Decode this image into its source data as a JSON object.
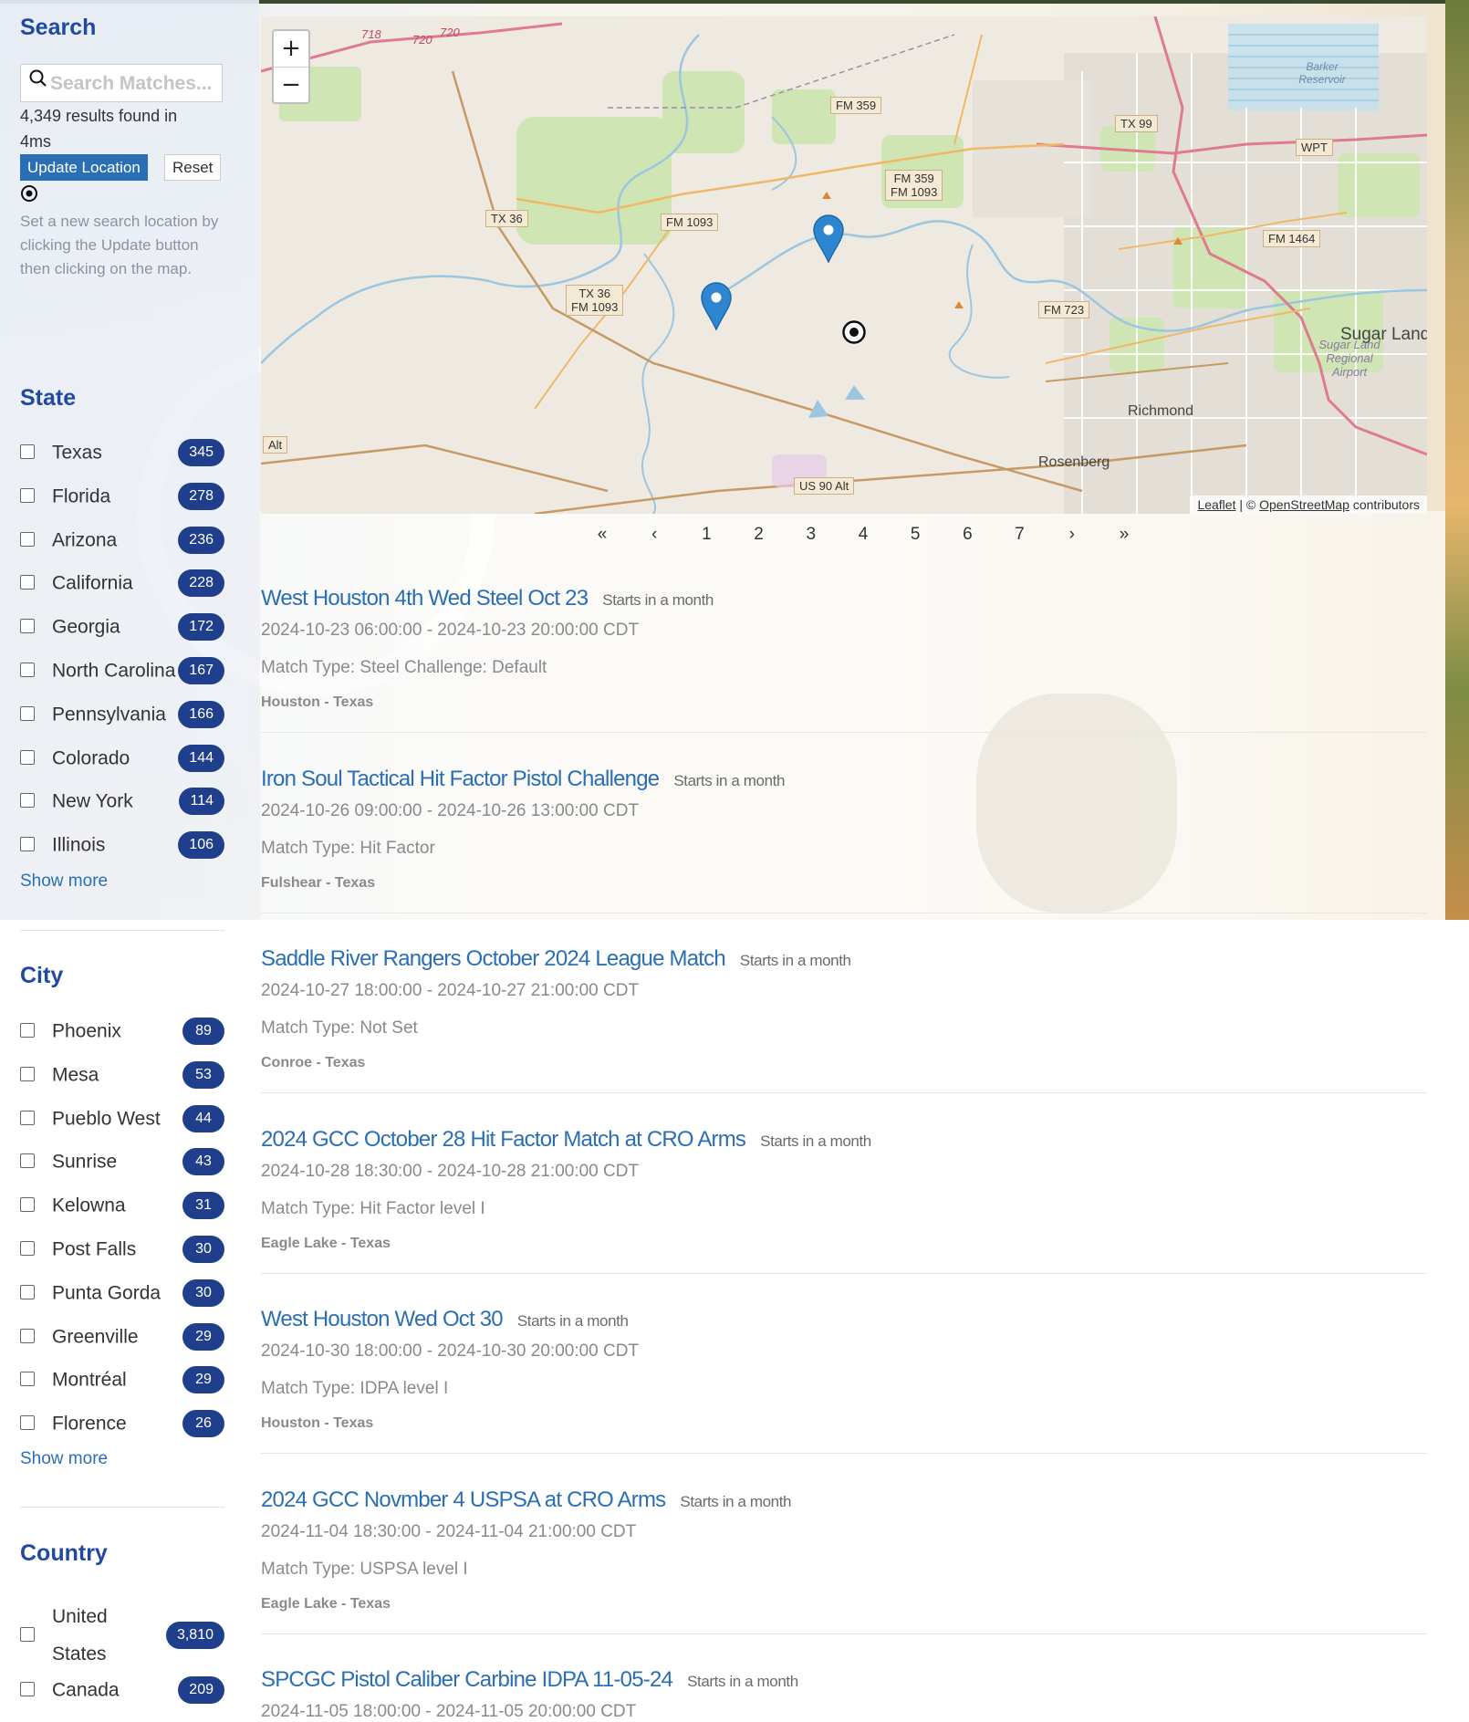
{
  "search": {
    "heading": "Search",
    "placeholder": "Search Matches...",
    "results_text": "4,349 results found in 4ms",
    "update_label": "Update Location",
    "reset_label": "Reset",
    "help_text": "Set a new search location by clicking the Update button then clicking on the map."
  },
  "state_facet": {
    "heading": "State",
    "items": [
      {
        "label": "Texas",
        "count": "345"
      },
      {
        "label": "Florida",
        "count": "278"
      },
      {
        "label": "Arizona",
        "count": "236"
      },
      {
        "label": "California",
        "count": "228"
      },
      {
        "label": "Georgia",
        "count": "172"
      },
      {
        "label": "North Carolina",
        "count": "167"
      },
      {
        "label": "Pennsylvania",
        "count": "166"
      },
      {
        "label": "Colorado",
        "count": "144"
      },
      {
        "label": "New York",
        "count": "114"
      },
      {
        "label": "Illinois",
        "count": "106"
      }
    ],
    "show_more": "Show more"
  },
  "city_facet": {
    "heading": "City",
    "items": [
      {
        "label": "Phoenix",
        "count": "89"
      },
      {
        "label": "Mesa",
        "count": "53"
      },
      {
        "label": "Pueblo West",
        "count": "44"
      },
      {
        "label": "Sunrise",
        "count": "43"
      },
      {
        "label": "Kelowna",
        "count": "31"
      },
      {
        "label": "Post Falls",
        "count": "30"
      },
      {
        "label": "Punta Gorda",
        "count": "30"
      },
      {
        "label": "Greenville",
        "count": "29"
      },
      {
        "label": "Montréal",
        "count": "29"
      },
      {
        "label": "Florence",
        "count": "26"
      }
    ],
    "show_more": "Show more"
  },
  "country_facet": {
    "heading": "Country",
    "items": [
      {
        "label_line1": "United",
        "label_line2": "States",
        "count": "3,810"
      },
      {
        "label": "Canada",
        "count": "209"
      }
    ]
  },
  "map": {
    "zoom_in": "+",
    "zoom_out": "−",
    "attribution_leaflet": "Leaflet",
    "attribution_sep": " | © ",
    "attribution_osm": "OpenStreetMap",
    "attribution_tail": " contributors",
    "labels": {
      "fm359": "FM 359",
      "fm359b": "FM 359",
      "fm1093b": "FM 1093",
      "tx99": "TX 99",
      "wpt": "WPT",
      "tx36": "TX 36",
      "fm1093": "FM 1093",
      "fm1464": "FM 1464",
      "tx36b": "TX 36",
      "fm1093c": "FM 1093",
      "fm723": "FM 723",
      "alt": "Alt",
      "us90": "US 90 Alt",
      "sugarland": "Sugar Land",
      "sugarland_airport": "Sugar Land Regional Airport",
      "richmond": "Richmond",
      "rosenberg": "Rosenberg",
      "barker": "Barker Reservoir",
      "r718": "718",
      "r720": "720",
      "r720b": "720"
    }
  },
  "pagination": [
    "«",
    "‹",
    "1",
    "2",
    "3",
    "4",
    "5",
    "6",
    "7",
    "›",
    "»"
  ],
  "results": [
    {
      "title": "West Houston 4th Wed Steel Oct 23",
      "starts": "Starts in a month",
      "dates": "2024-10-23 06:00:00 - 2024-10-23 20:00:00 CDT",
      "match_type": "Match Type: Steel Challenge: Default",
      "location": "Houston - Texas"
    },
    {
      "title": "Iron Soul Tactical Hit Factor Pistol Challenge",
      "starts": "Starts in a month",
      "dates": "2024-10-26 09:00:00 - 2024-10-26 13:00:00 CDT",
      "match_type": "Match Type: Hit Factor",
      "location": "Fulshear - Texas"
    },
    {
      "title": "Saddle River Rangers October 2024 League Match",
      "starts": "Starts in a month",
      "dates": "2024-10-27 18:00:00 - 2024-10-27 21:00:00 CDT",
      "match_type": "Match Type: Not Set",
      "location": "Conroe - Texas"
    },
    {
      "title": "2024 GCC October 28 Hit Factor Match at CRO Arms",
      "starts": "Starts in a month",
      "dates": "2024-10-28 18:30:00 - 2024-10-28 21:00:00 CDT",
      "match_type": "Match Type: Hit Factor level I",
      "location": "Eagle Lake - Texas"
    },
    {
      "title": "West Houston Wed Oct 30",
      "starts": "Starts in a month",
      "dates": "2024-10-30 18:00:00 - 2024-10-30 20:00:00 CDT",
      "match_type": "Match Type: IDPA level I",
      "location": "Houston - Texas"
    },
    {
      "title": "2024 GCC Novmber 4 USPSA at CRO Arms",
      "starts": "Starts in a month",
      "dates": "2024-11-04 18:30:00 - 2024-11-04 21:00:00 CDT",
      "match_type": "Match Type: USPSA level I",
      "location": "Eagle Lake - Texas"
    },
    {
      "title": "SPCGC Pistol Caliber Carbine IDPA 11-05-24",
      "starts": "Starts in a month",
      "dates": "2024-11-05 18:00:00 - 2024-11-05 20:00:00 CDT",
      "match_type": "",
      "location": ""
    }
  ],
  "colors": {
    "accent": "#2a6fb4",
    "heading": "#1f4aa0",
    "badge": "#1f3f8c"
  }
}
